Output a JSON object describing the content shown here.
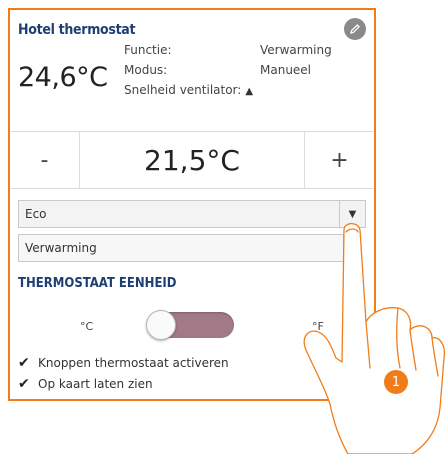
{
  "header": {
    "title": "Hotel thermostat",
    "edit_icon": "pencil-icon"
  },
  "status": {
    "current_temperature": "24,6°C",
    "labels": [
      "Functie:",
      "Modus:",
      "Snelheid ventilator:"
    ],
    "values": [
      "Verwarming",
      "Manueel"
    ],
    "fan_icon": "warning-icon"
  },
  "setpoint": {
    "minus_label": "-",
    "value": "21,5°C",
    "plus_label": "+"
  },
  "preset_select": {
    "value": "Eco"
  },
  "mode_select": {
    "value": "Verwarming"
  },
  "unit_section": {
    "title": "THERMOSTAAT EENHEID",
    "celsius_label": "°C",
    "fahrenheit_label": "°F"
  },
  "options": [
    {
      "label": "Knoppen thermostaat activeren",
      "checked": true
    },
    {
      "label": "Op kaart laten zien",
      "checked": true
    }
  ],
  "callout": {
    "number": "1"
  },
  "colors": {
    "accent": "#f07d1a",
    "heading": "#1f3f73",
    "toggle": "#a27a87"
  }
}
